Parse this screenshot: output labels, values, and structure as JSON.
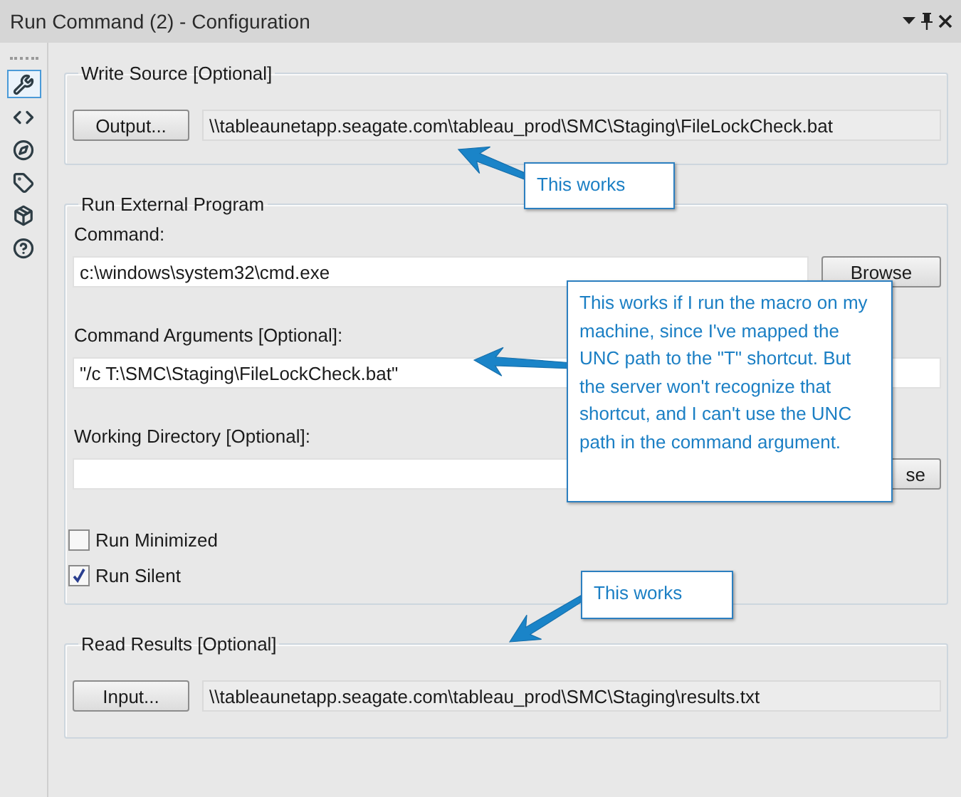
{
  "window": {
    "title": "Run Command (2) - Configuration"
  },
  "sidebar_tabs": [
    {
      "selected": true
    },
    {
      "selected": false
    },
    {
      "selected": false
    },
    {
      "selected": false
    },
    {
      "selected": false
    },
    {
      "selected": false
    }
  ],
  "write_source": {
    "title": "Write Source [Optional]",
    "button": "Output...",
    "value": "\\\\tableaunetapp.seagate.com\\tableau_prod\\SMC\\Staging\\FileLockCheck.bat"
  },
  "run_external_program": {
    "title": "Run External Program",
    "command": {
      "label": "Command:",
      "value": "c:\\windows\\system32\\cmd.exe",
      "button": "Browse"
    },
    "arguments": {
      "label": "Command Arguments [Optional]:",
      "value": "\"/c T:\\SMC\\Staging\\FileLockCheck.bat\""
    },
    "working_directory": {
      "label": "Working Directory [Optional]:",
      "button": "se"
    },
    "checkboxes": [
      {
        "label": "Run Minimized",
        "checked": false
      },
      {
        "label": "Run Silent",
        "checked": true
      }
    ]
  },
  "read_results": {
    "title": "Read Results [Optional]",
    "button": "Input...",
    "value": "\\\\tableaunetapp.seagate.com\\tableau_prod\\SMC\\Staging\\results.txt"
  },
  "callouts": [
    {
      "text": "This works"
    },
    {
      "text": "This works if I run the macro on my machine, since I've mapped the UNC path to the \"T\" shortcut.  But the server won't recognize that shortcut, and I can't use the UNC path in the command argument."
    },
    {
      "text": "This works"
    }
  ]
}
